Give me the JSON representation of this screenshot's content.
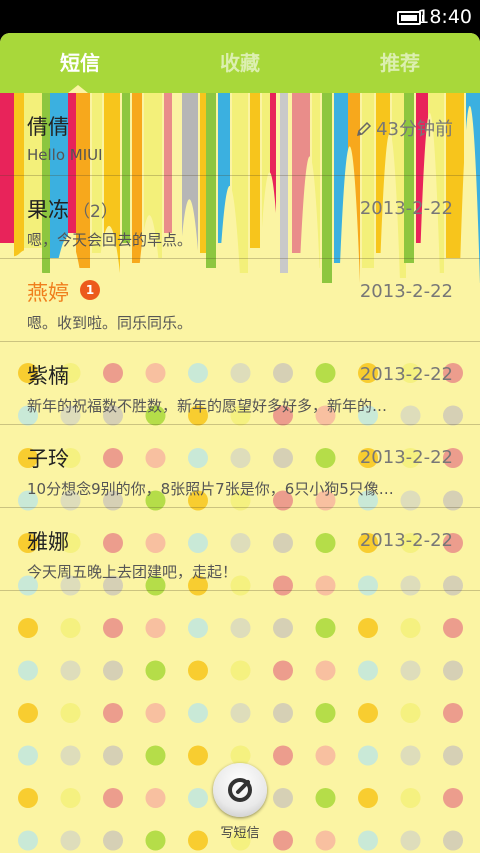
{
  "status_bar": {
    "time": "18:40",
    "battery_icon": "battery-icon"
  },
  "tabs": [
    {
      "label": "短信",
      "active": true
    },
    {
      "label": "收藏",
      "active": false
    },
    {
      "label": "推荐",
      "active": false
    }
  ],
  "conversations": [
    {
      "name": "倩倩",
      "count": "",
      "unread": false,
      "badge": "",
      "date": "43分钟前",
      "preview": "Hello MIUI",
      "draft": true
    },
    {
      "name": "果冻",
      "count": "（2）",
      "unread": false,
      "badge": "",
      "date": "2013-2-22",
      "preview": "嗯，今天会回去的早点。",
      "draft": false
    },
    {
      "name": "燕婷",
      "count": "",
      "unread": true,
      "badge": "1",
      "date": "2013-2-22",
      "preview": "嗯。收到啦。同乐同乐。",
      "draft": false
    },
    {
      "name": "紫楠",
      "count": "",
      "unread": false,
      "badge": "",
      "date": "2013-2-22",
      "preview": "新年的祝福数不胜数，新年的愿望好多好多，新年的…",
      "draft": false
    },
    {
      "name": "子玲",
      "count": "",
      "unread": false,
      "badge": "",
      "date": "2013-2-22",
      "preview": "10分想念9别的你，8张照片7张是你，6只小狗5只像…",
      "draft": false
    },
    {
      "name": "雅娜",
      "count": "",
      "unread": false,
      "badge": "",
      "date": "2013-2-22",
      "preview": "今天周五晚上去团建吧，走起！",
      "draft": false
    }
  ],
  "compose": {
    "label": "写短信",
    "icon": "compose-icon"
  },
  "colors": {
    "tab_bar": "#a8d83a",
    "background": "#fbf4a3",
    "unread_name": "#f07e1c",
    "badge": "#ec5a1c"
  }
}
